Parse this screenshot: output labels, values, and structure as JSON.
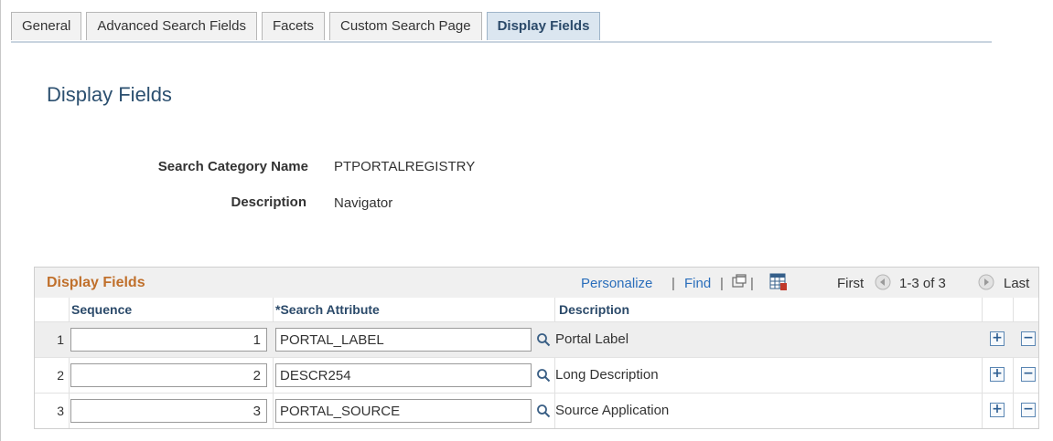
{
  "tabs": [
    {
      "label": "General",
      "active": false
    },
    {
      "label": "Advanced Search Fields",
      "active": false
    },
    {
      "label": "Facets",
      "active": false
    },
    {
      "label": "Custom Search Page",
      "active": false
    },
    {
      "label": "Display Fields",
      "active": true
    }
  ],
  "page_title": "Display Fields",
  "fields": {
    "search_category_label": "Search Category Name",
    "search_category_value": "PTPORTALREGISTRY",
    "description_label": "Description",
    "description_value": "Navigator"
  },
  "grid": {
    "title": "Display Fields",
    "personalize": "Personalize",
    "separator": "|",
    "find": "Find",
    "first": "First",
    "range": "1-3 of 3",
    "last": "Last",
    "columns": {
      "sequence": "Sequence",
      "search_attribute": "*Search Attribute",
      "description": "Description"
    },
    "rows": [
      {
        "num": "1",
        "sequence": "1",
        "attribute": "PORTAL_LABEL",
        "description": "Portal Label"
      },
      {
        "num": "2",
        "sequence": "2",
        "attribute": "DESCR254",
        "description": "Long Description"
      },
      {
        "num": "3",
        "sequence": "3",
        "attribute": "PORTAL_SOURCE",
        "description": "Source Application"
      }
    ],
    "add_symbol": "+",
    "remove_symbol": "−"
  },
  "icons": {
    "lookup": "magnifier-icon",
    "new_window": "new-window-icon",
    "download": "download-to-excel-icon",
    "prev": "previous-arrow-icon",
    "next": "next-arrow-icon"
  },
  "colors": {
    "title": "#2c5070",
    "grid_title": "#c0702c",
    "link": "#2a6ebb"
  }
}
